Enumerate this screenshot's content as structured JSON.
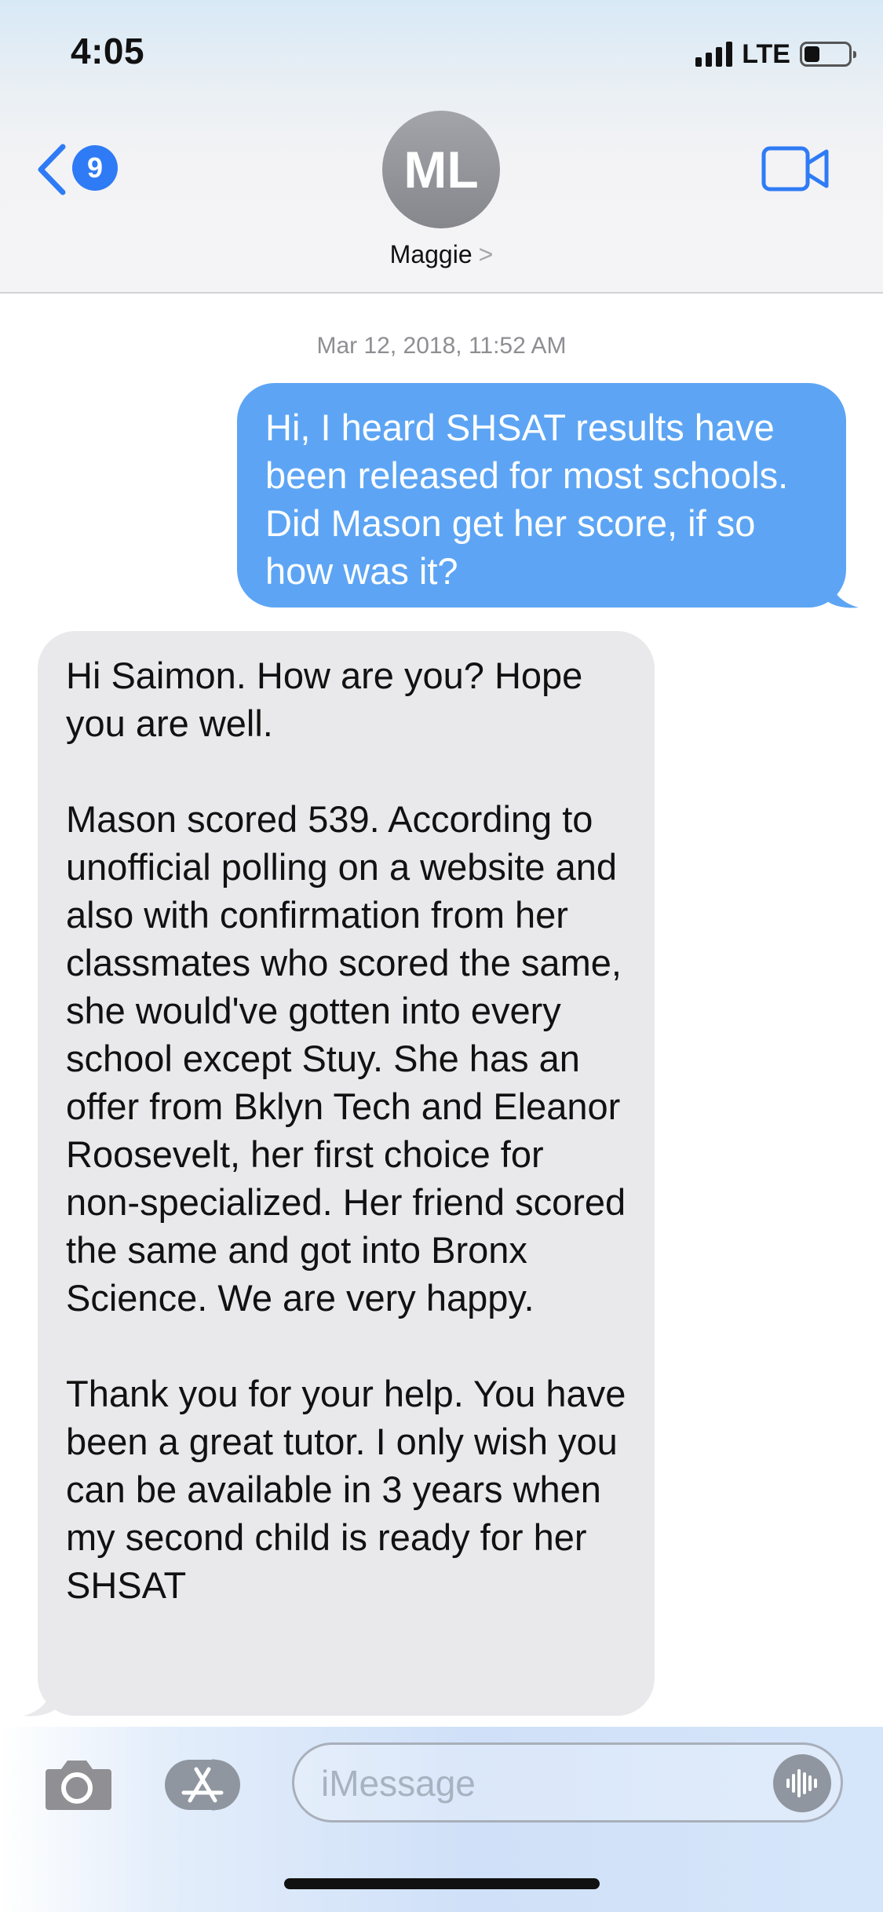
{
  "status_bar": {
    "time": "4:05",
    "network": "LTE",
    "signal_bars": 4,
    "battery_level": 0.35
  },
  "nav": {
    "back_count": "9",
    "avatar_initials": "ML",
    "contact_name": "Maggie",
    "contact_chevron": ">",
    "video_icon": "video-camera-icon"
  },
  "conversation": {
    "timestamp": "Mar 12, 2018, 11:52 AM",
    "messages": [
      {
        "direction": "outgoing",
        "paragraphs": [
          "Hi, I heard SHSAT results have been released for most schools. Did Mason get her score, if so how was it?"
        ]
      },
      {
        "direction": "incoming",
        "paragraphs": [
          "Hi Saimon. How are you? Hope you are well.",
          "Mason scored 539. According to unofficial polling on a website and also with confirmation from her classmates who scored the same, she would've gotten into every school except Stuy. She has an offer from Bklyn Tech and Eleanor Roosevelt, her first choice for non-specialized. Her friend scored the same and got into Bronx Science. We are very happy.",
          "Thank you for your help. You have been a great tutor. I only wish you can be available in 3 years when my second child is ready for her SHSAT"
        ]
      }
    ]
  },
  "input_bar": {
    "placeholder": "iMessage",
    "camera_icon": "camera-icon",
    "apps_icon": "app-store-icon",
    "audio_icon": "audio-waveform-icon"
  },
  "colors": {
    "outgoing_bubble": "#5da5f4",
    "incoming_bubble": "#e9e9eb",
    "accent": "#2f7bf5"
  }
}
